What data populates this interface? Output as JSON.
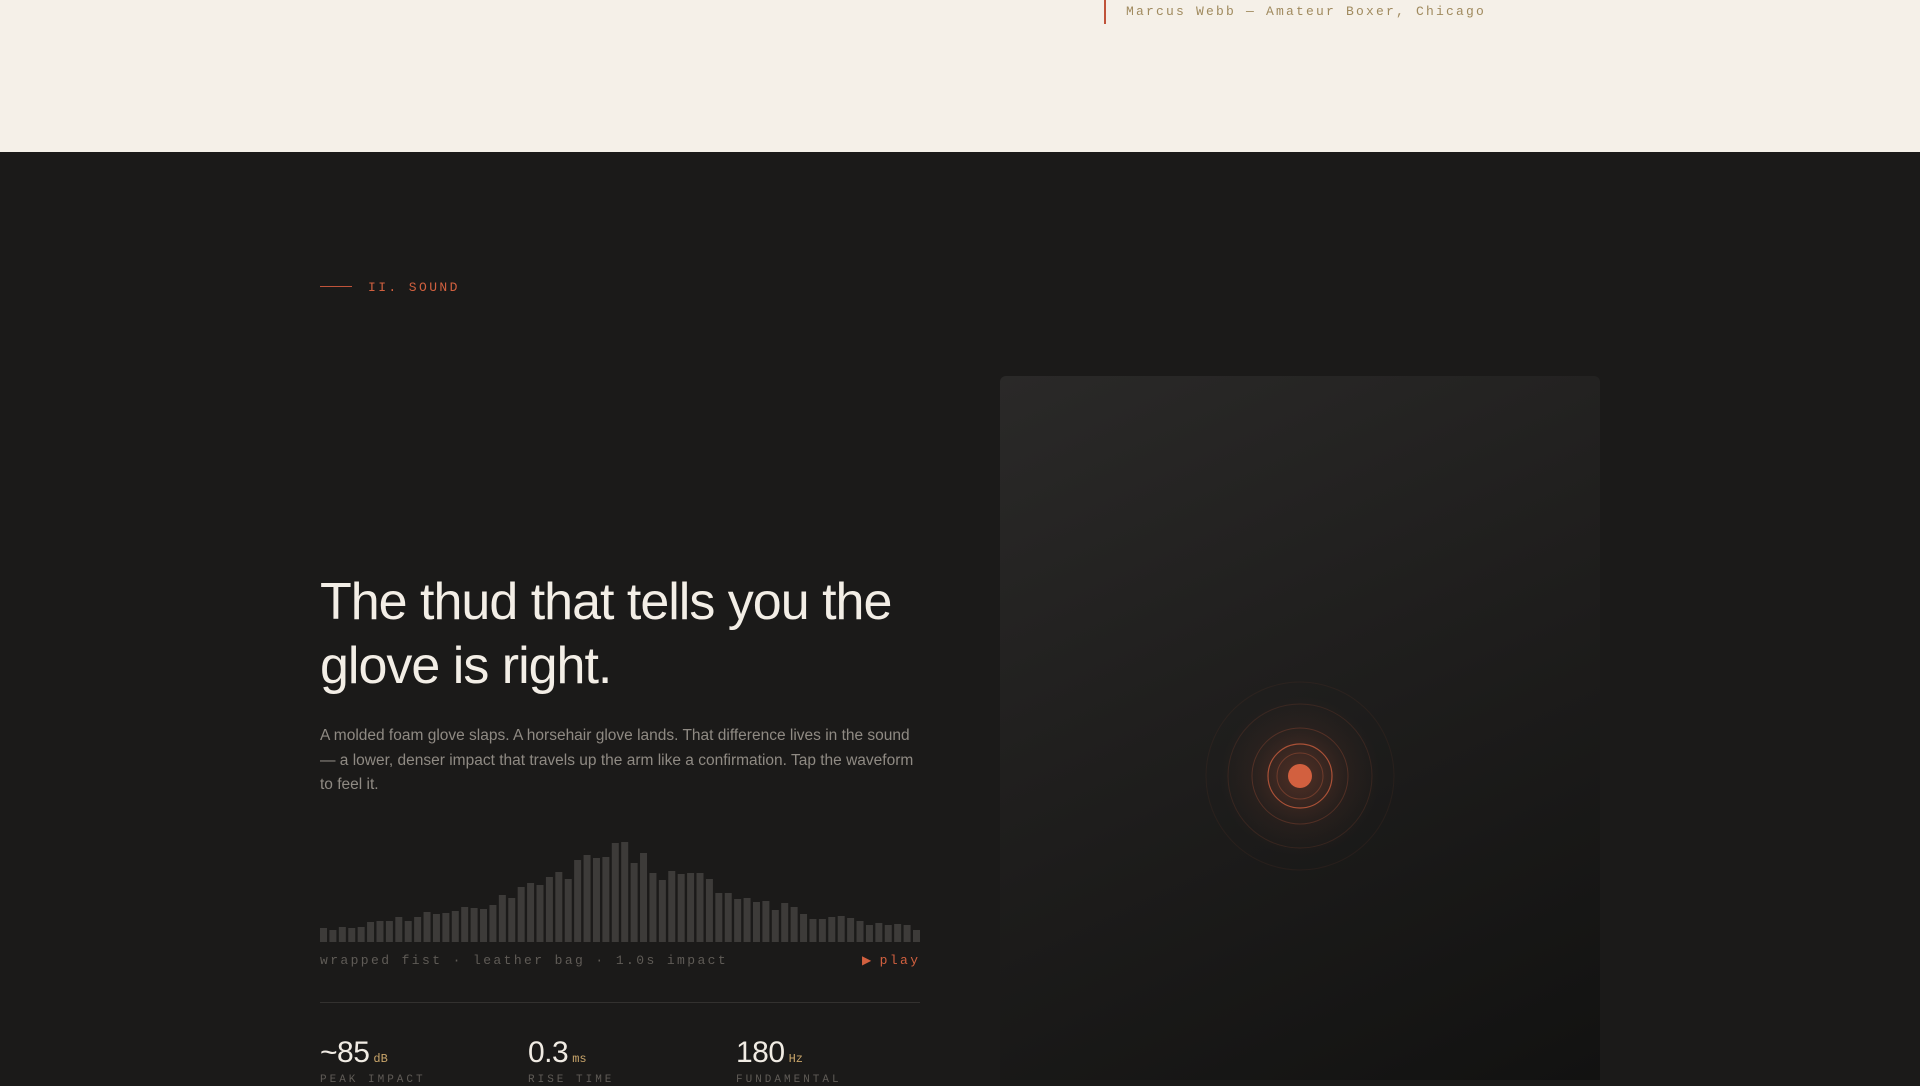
{
  "testimonial": {
    "attribution": "Marcus Webb — Amateur Boxer, Chicago"
  },
  "section": {
    "label": "II. SOUND",
    "headline": "The thud that tells you the glove is right.",
    "body": "A molded foam glove slaps. A horsehair glove lands. That difference lives in the sound — a lower, denser impact that travels up the arm like a confirmation. Tap the waveform to feel it."
  },
  "waveform": {
    "levels": [
      0.14,
      0.12,
      0.15,
      0.14,
      0.15,
      0.2,
      0.21,
      0.21,
      0.25,
      0.21,
      0.25,
      0.3,
      0.28,
      0.29,
      0.31,
      0.35,
      0.34,
      0.33,
      0.37,
      0.47,
      0.44,
      0.55,
      0.59,
      0.57,
      0.65,
      0.7,
      0.63,
      0.82,
      0.87,
      0.84,
      0.85,
      0.99,
      1.0,
      0.79,
      0.89,
      0.69,
      0.62,
      0.71,
      0.68,
      0.69,
      0.69,
      0.63,
      0.49,
      0.49,
      0.43,
      0.44,
      0.4,
      0.41,
      0.32,
      0.39,
      0.35,
      0.28,
      0.23,
      0.23,
      0.25,
      0.26,
      0.24,
      0.21,
      0.17,
      0.19,
      0.17,
      0.18,
      0.17,
      0.12
    ],
    "caption": "wrapped fist · leather bag · 1.0s impact",
    "play_label": "play",
    "play_icon": "play-icon",
    "bar_color": "#3d3b39"
  },
  "stats": [
    {
      "value": "~85",
      "unit": "dB",
      "label": "PEAK IMPACT"
    },
    {
      "value": "0.3",
      "unit": "ms",
      "label": "RISE TIME"
    },
    {
      "value": "180",
      "unit": "Hz",
      "label": "FUNDAMENTAL"
    }
  ],
  "colors": {
    "accent": "#d2603f",
    "cream": "#f5f0e8",
    "dark": "#1b1a19",
    "gold": "#c9a56a"
  }
}
